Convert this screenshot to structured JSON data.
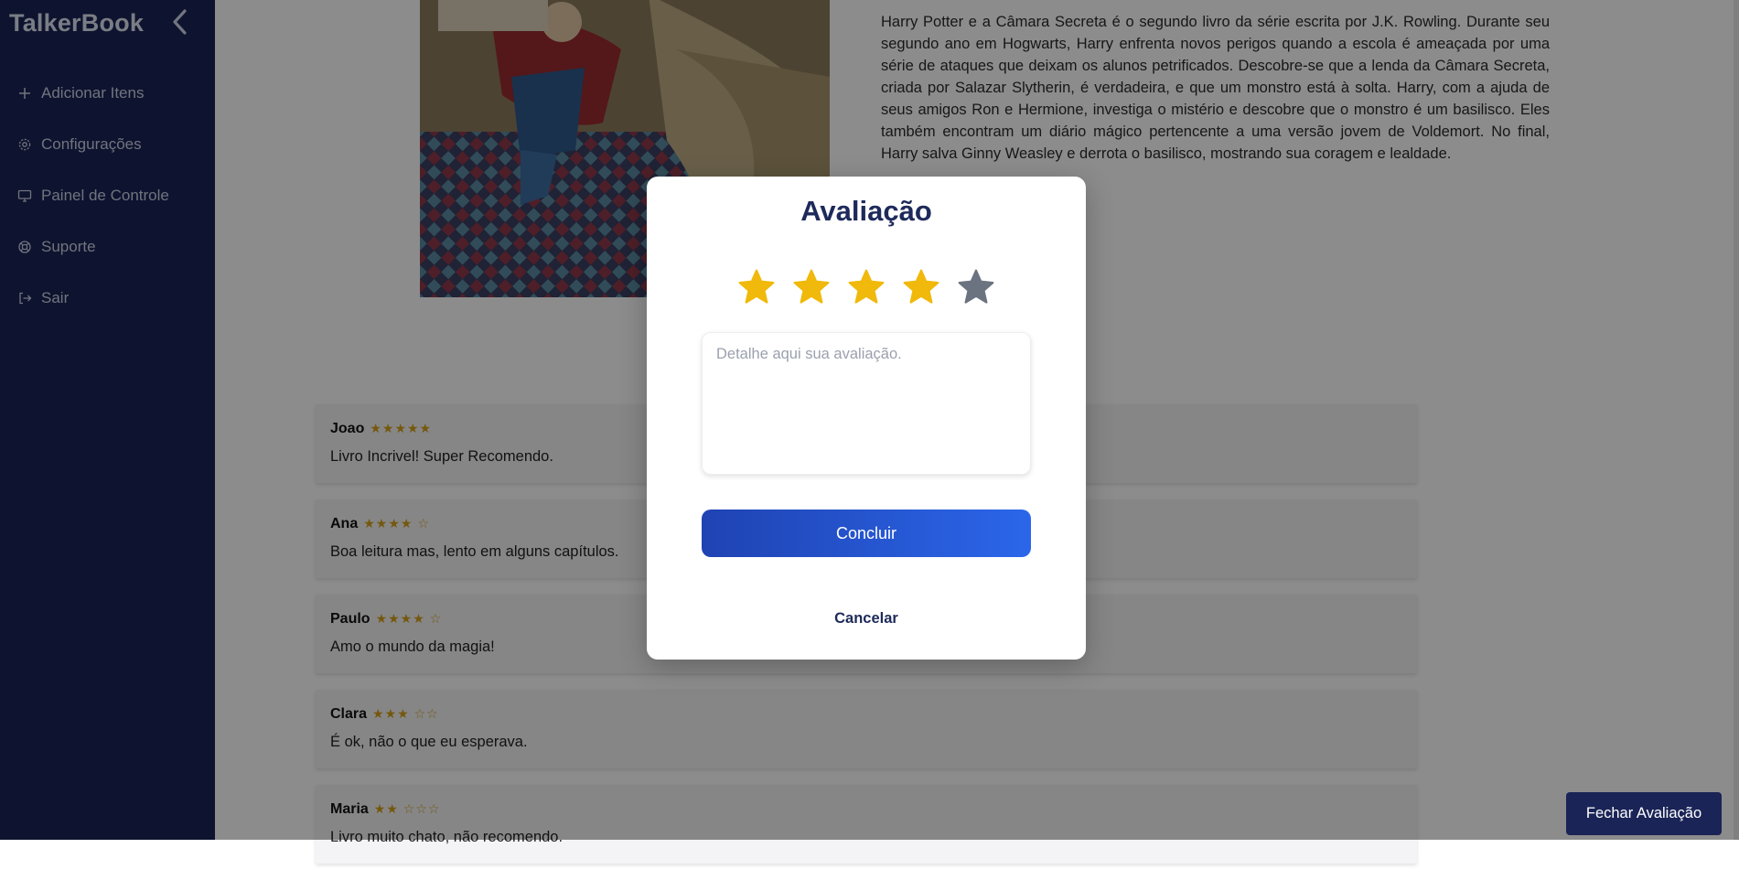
{
  "sidebar": {
    "brand": "TalkerBook",
    "items": [
      {
        "label": "Adicionar Itens",
        "icon": "plus-icon"
      },
      {
        "label": "Configurações",
        "icon": "gear-icon"
      },
      {
        "label": "Painel de Controle",
        "icon": "monitor-icon"
      },
      {
        "label": "Suporte",
        "icon": "lifebuoy-icon"
      },
      {
        "label": "Sair",
        "icon": "logout-icon"
      }
    ]
  },
  "book": {
    "description": "Harry Potter e a Câmara Secreta é o segundo livro da série escrita por J.K. Rowling. Durante seu segundo ano em Hogwarts, Harry enfrenta novos perigos quando a escola é ameaçada por uma série de ataques que deixam os alunos petrificados. Descobre-se que a lenda da Câmara Secreta, criada por Salazar Slytherin, é verdadeira, e que um monstro está à solta. Harry, com a ajuda de seus amigos Ron e Hermione, investiga o mistério e descobre que o monstro é um basilisco. Eles também encontram um diário mágico pertencente a uma versão jovem de Voldemort. No final, Harry salva Ginny Weasley e derrota o basilisco, mostrando sua coragem e lealdade."
  },
  "reviews": [
    {
      "name": "Joao",
      "stars": "★★★★★",
      "text": "Livro Incrivel! Super Recomendo."
    },
    {
      "name": "Ana",
      "stars": "★★★★ ☆",
      "text": "Boa leitura mas, lento em alguns capítulos."
    },
    {
      "name": "Paulo",
      "stars": "★★★★ ☆",
      "text": "Amo o mundo da magia!"
    },
    {
      "name": "Clara",
      "stars": "★★★ ☆☆",
      "text": "É ok, não o que eu esperava."
    },
    {
      "name": "Maria",
      "stars": "★★ ☆☆☆",
      "text": "Livro muito chato, não recomendo."
    }
  ],
  "modal": {
    "title": "Avaliação",
    "rating": 4,
    "max_rating": 5,
    "placeholder": "Detalhe aqui sua avaliação.",
    "submit_label": "Concluir",
    "cancel_label": "Cancelar"
  },
  "close_review_label": "Fechar Avaliação",
  "colors": {
    "sidebar_bg": "#1a2456",
    "star_active": "#f0b90b",
    "star_inactive": "#6b7280",
    "primary": "#2b5fe0"
  }
}
